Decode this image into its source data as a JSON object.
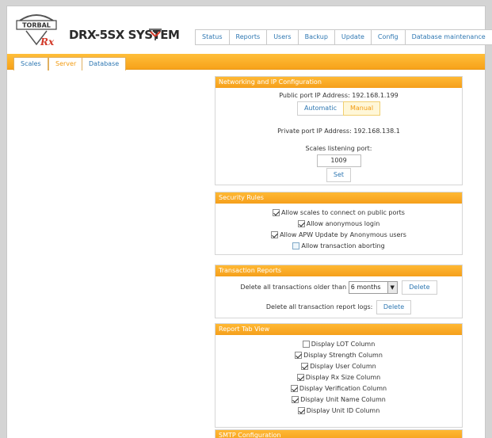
{
  "header": {
    "logo_text": "TORBAL",
    "logo_sub": "Rx",
    "system_title": "DRX-5SX SYSTEM",
    "nav": [
      "Status",
      "Reports",
      "Users",
      "Backup",
      "Update",
      "Config",
      "Database maintenance"
    ]
  },
  "tabs": [
    "Scales",
    "Server",
    "Database"
  ],
  "active_tab": "Server",
  "networking": {
    "title": "Networking and IP Configuration",
    "public_label": "Public port IP Address: 192.168.1.199",
    "mode_buttons": [
      "Automatic",
      "Manual"
    ],
    "selected_mode": "Manual",
    "private_label": "Private port IP Address: 192.168.138.1",
    "port_label": "Scales listening port:",
    "port_value": "1009",
    "set_label": "Set"
  },
  "security": {
    "title": "Security Rules",
    "rules": [
      {
        "label": "Allow scales to connect on public ports",
        "checked": true
      },
      {
        "label": "Allow anonymous login",
        "checked": true
      },
      {
        "label": "Allow APW Update by Anonymous users",
        "checked": true
      },
      {
        "label": "Allow transaction aborting",
        "checked": false
      }
    ]
  },
  "transactions": {
    "title": "Transaction Reports",
    "delete_older_label": "Delete all transactions older than",
    "period_value": "6 months",
    "delete_label": "Delete",
    "delete_logs_label": "Delete all transaction report logs:",
    "delete_logs_btn": "Delete"
  },
  "report_view": {
    "title": "Report Tab View",
    "columns": [
      {
        "label": "Display LOT Column",
        "checked": false
      },
      {
        "label": "Display Strength Column",
        "checked": true
      },
      {
        "label": "Display User Column",
        "checked": true
      },
      {
        "label": "Display Rx Size Column",
        "checked": true
      },
      {
        "label": "Display Verification Column",
        "checked": true
      },
      {
        "label": "Display Unit Name Column",
        "checked": true
      },
      {
        "label": "Display Unit ID Column",
        "checked": true
      }
    ]
  },
  "smtp": {
    "title": "SMTP Configuration"
  }
}
